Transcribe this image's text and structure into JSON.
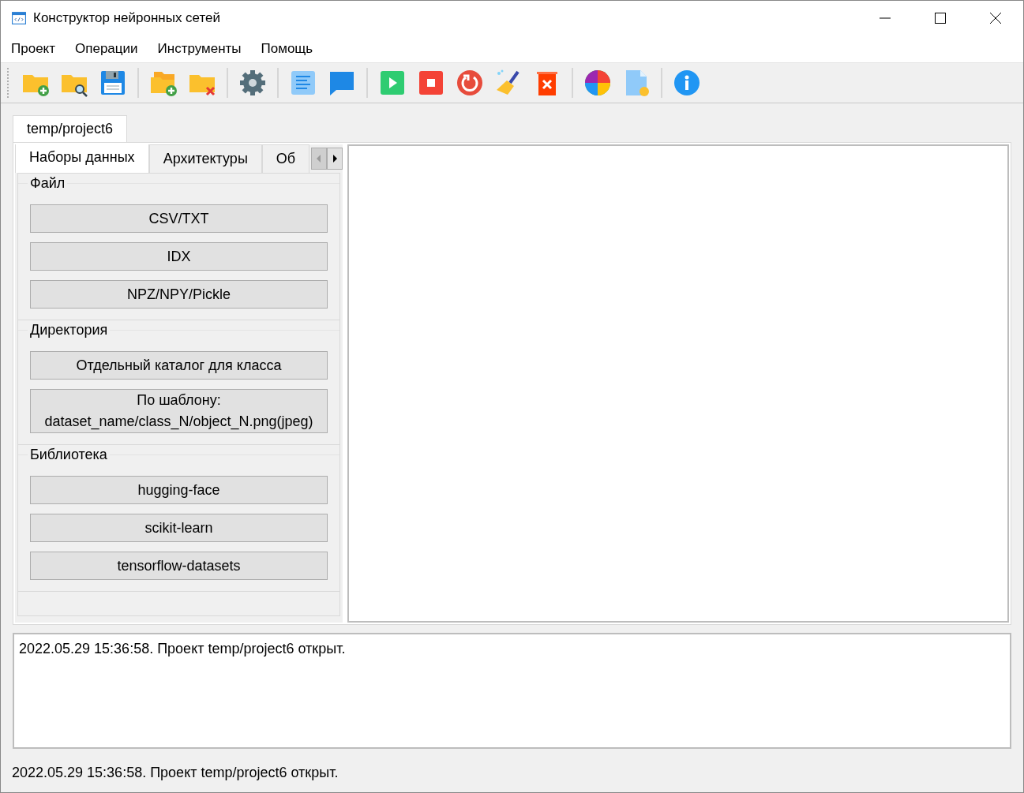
{
  "window": {
    "title": "Конструктор нейронных сетей"
  },
  "menu": [
    "Проект",
    "Операции",
    "Инструменты",
    "Помощь"
  ],
  "project_tabs": [
    {
      "label": "temp/project6",
      "selected": true
    }
  ],
  "panel_tabs": [
    {
      "label": "Наборы данных",
      "selected": true
    },
    {
      "label": "Архитектуры",
      "selected": false
    },
    {
      "label": "Об",
      "selected": false
    }
  ],
  "tab_scroll": {
    "left_disabled": true,
    "right_disabled": false
  },
  "groups": [
    {
      "title": "Файл",
      "buttons": [
        "CSV/TXT",
        "IDX",
        "NPZ/NPY/Pickle"
      ]
    },
    {
      "title": "Директория",
      "buttons": [
        "Отдельный каталог для класса",
        "По шаблону:\ndataset_name/class_N/object_N.png(jpeg)"
      ]
    },
    {
      "title": "Библиотека",
      "buttons": [
        "hugging-face",
        "scikit-learn",
        "tensorflow-datasets"
      ]
    }
  ],
  "log": [
    "2022.05.29 15:36:58. Проект temp/project6 открыт."
  ],
  "status_bar": "2022.05.29 15:36:58. Проект temp/project6 открыт."
}
